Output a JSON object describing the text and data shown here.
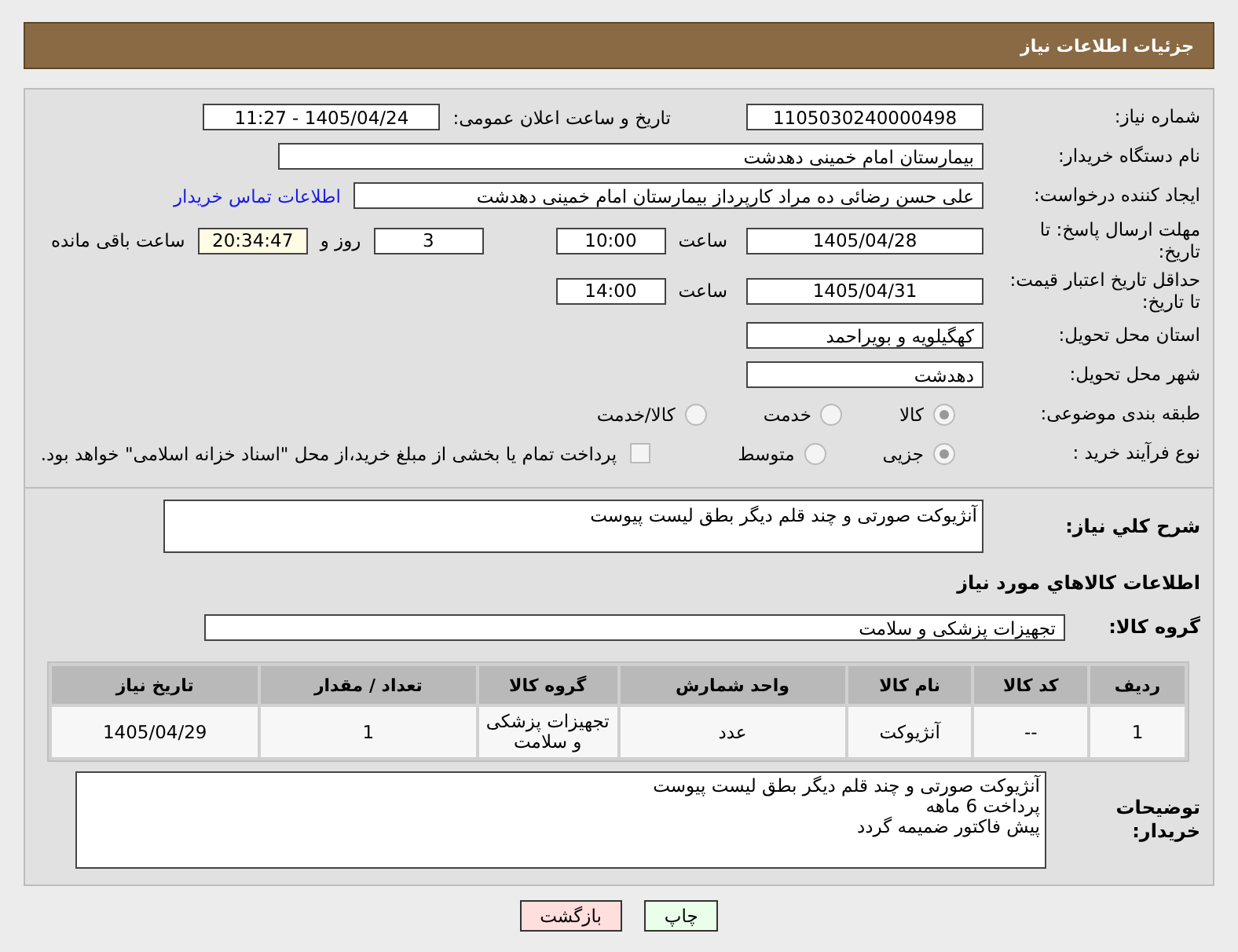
{
  "header": {
    "title": "جزئیات اطلاعات نیاز"
  },
  "need_number": {
    "label": "شماره نیاز:",
    "value": "1105030240000498"
  },
  "announce": {
    "label": "تاریخ و ساعت اعلان عمومی:",
    "value": "1405/04/24 - 11:27"
  },
  "buyer": {
    "label": "نام دستگاه خریدار:",
    "value": "بیمارستان امام خمینی دهدشت"
  },
  "creator": {
    "label": "ایجاد کننده درخواست:",
    "value": "علی حسن رضائی ده مراد کارپرداز بیمارستان امام خمینی دهدشت",
    "link": "اطلاعات تماس خریدار"
  },
  "deadline": {
    "label": "مهلت ارسال پاسخ: تا تاریخ:",
    "date": "1405/04/28",
    "time_label": "ساعت",
    "time": "10:00",
    "days": "3",
    "days_label": "روز و",
    "remaining": "20:34:47",
    "remaining_label": "ساعت باقی مانده"
  },
  "validity": {
    "label": "حداقل تاریخ اعتبار قیمت: تا تاریخ:",
    "date": "1405/04/31",
    "time_label": "ساعت",
    "time": "14:00"
  },
  "province": {
    "label": "استان محل تحویل:",
    "value": "کهگیلویه و بویراحمد"
  },
  "city": {
    "label": "شهر محل تحویل:",
    "value": "دهدشت"
  },
  "category": {
    "label": "طبقه بندی موضوعی:",
    "options": [
      {
        "label": "کالا",
        "selected": true
      },
      {
        "label": "خدمت",
        "selected": false
      },
      {
        "label": "کالا/خدمت",
        "selected": false
      }
    ]
  },
  "process": {
    "label": "نوع فرآیند خرید :",
    "options": [
      {
        "label": "جزیی",
        "selected": true
      },
      {
        "label": "متوسط",
        "selected": false
      }
    ],
    "treasury": {
      "label": "پرداخت تمام یا بخشی از مبلغ خرید،از محل \"اسناد خزانه اسلامی\" خواهد بود.",
      "checked": false
    }
  },
  "description": {
    "label": "شرح کلي نياز:",
    "value": "آنژیوکت صورتی و چند قلم دیگر بطق لیست پیوست"
  },
  "goods_title": "اطلاعات کالاهاي مورد نياز",
  "goods_group": {
    "label": "گروه کالا:",
    "value": "تجهیزات پزشکی و سلامت"
  },
  "table": {
    "columns": [
      "ردیف",
      "کد کالا",
      "نام کالا",
      "واحد شمارش",
      "گروه کالا",
      "تعداد / مقدار",
      "تاریخ نیاز"
    ],
    "rows": [
      [
        "1",
        "--",
        "آنژیوکت",
        "عدد",
        "تجهیزات پزشکی و سلامت",
        "1",
        "1405/04/29"
      ]
    ]
  },
  "buyer_notes": {
    "label": "توضیحات خریدار:",
    "lines": [
      "آنژیوکت صورتی و چند قلم دیگر بطق لیست پیوست",
      "پرداخت 6 ماهه",
      "پیش فاکتور ضمیمه گردد"
    ]
  },
  "buttons": [
    {
      "label": "چاپ",
      "kind": "print"
    },
    {
      "label": "بازگشت",
      "kind": "back"
    }
  ]
}
